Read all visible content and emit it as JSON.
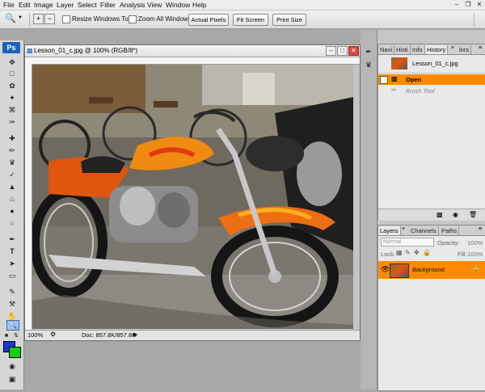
{
  "menu": [
    "File",
    "Edit",
    "Image",
    "Layer",
    "Select",
    "Filter",
    "Analysis",
    "View",
    "Window",
    "Help"
  ],
  "options": {
    "resize_windows_label": "Resize Windows To Fit",
    "zoom_all_label": "Zoom All Windows",
    "actual_pixels": "Actual Pixels",
    "fit_screen": "Fit Screen",
    "print_size": "Print Size"
  },
  "toolbox": {
    "app_logo": "Ps"
  },
  "document": {
    "title": "Lesson_01_c.jpg @ 100% (RGB/8*)",
    "zoom": "100%",
    "doc_info": "Doc: 857.8K/857.8K"
  },
  "history_panel": {
    "tabs": [
      "Navi",
      "Histi",
      "Info",
      "History",
      "lors"
    ],
    "snapshot_name": "Lesson_01_c.jpg",
    "states": [
      "Open",
      "Brush Tool"
    ]
  },
  "layers_panel": {
    "tabs": [
      "Layers",
      "Channels",
      "Paths"
    ],
    "blend_mode": "Normal",
    "opacity_label": "Opacity:",
    "opacity_value": "100%",
    "lock_label": "Lock:",
    "fill_label": "Fill:",
    "fill_value": "100%",
    "layer_name": "Background"
  },
  "colors": {
    "foreground": "#1b34e0",
    "background": "#10d010",
    "selection": "#ff8a00",
    "app_blue": "#1c63b8"
  }
}
